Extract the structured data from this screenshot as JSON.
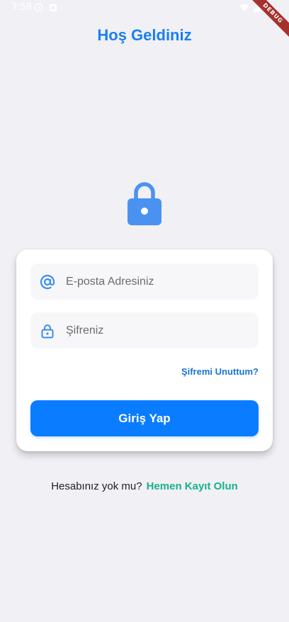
{
  "status_bar": {
    "time": "7:58",
    "left_icons": [
      "alarm-icon",
      "notification-icon"
    ],
    "right_icons": [
      "wifi-icon",
      "signal-icon",
      "battery-icon"
    ]
  },
  "debug_banner": "DEBUG",
  "page": {
    "title": "Hoş Geldiniz"
  },
  "form": {
    "email": {
      "icon": "at-sign-icon",
      "placeholder": "E-posta Adresiniz",
      "value": ""
    },
    "password": {
      "icon": "lock-icon",
      "placeholder": "Şifreniz",
      "value": ""
    },
    "forgot_password": "Şifremi Unuttum?",
    "submit": "Giriş Yap"
  },
  "signup": {
    "prompt": "Hesabınız yok mu?",
    "link": "Hemen Kayıt Olun"
  },
  "colors": {
    "background": "#f1f0f5",
    "primary": "#0a7cff",
    "title": "#1a7ff0",
    "link_green": "#17b28d",
    "debug_red": "#a5322e"
  }
}
